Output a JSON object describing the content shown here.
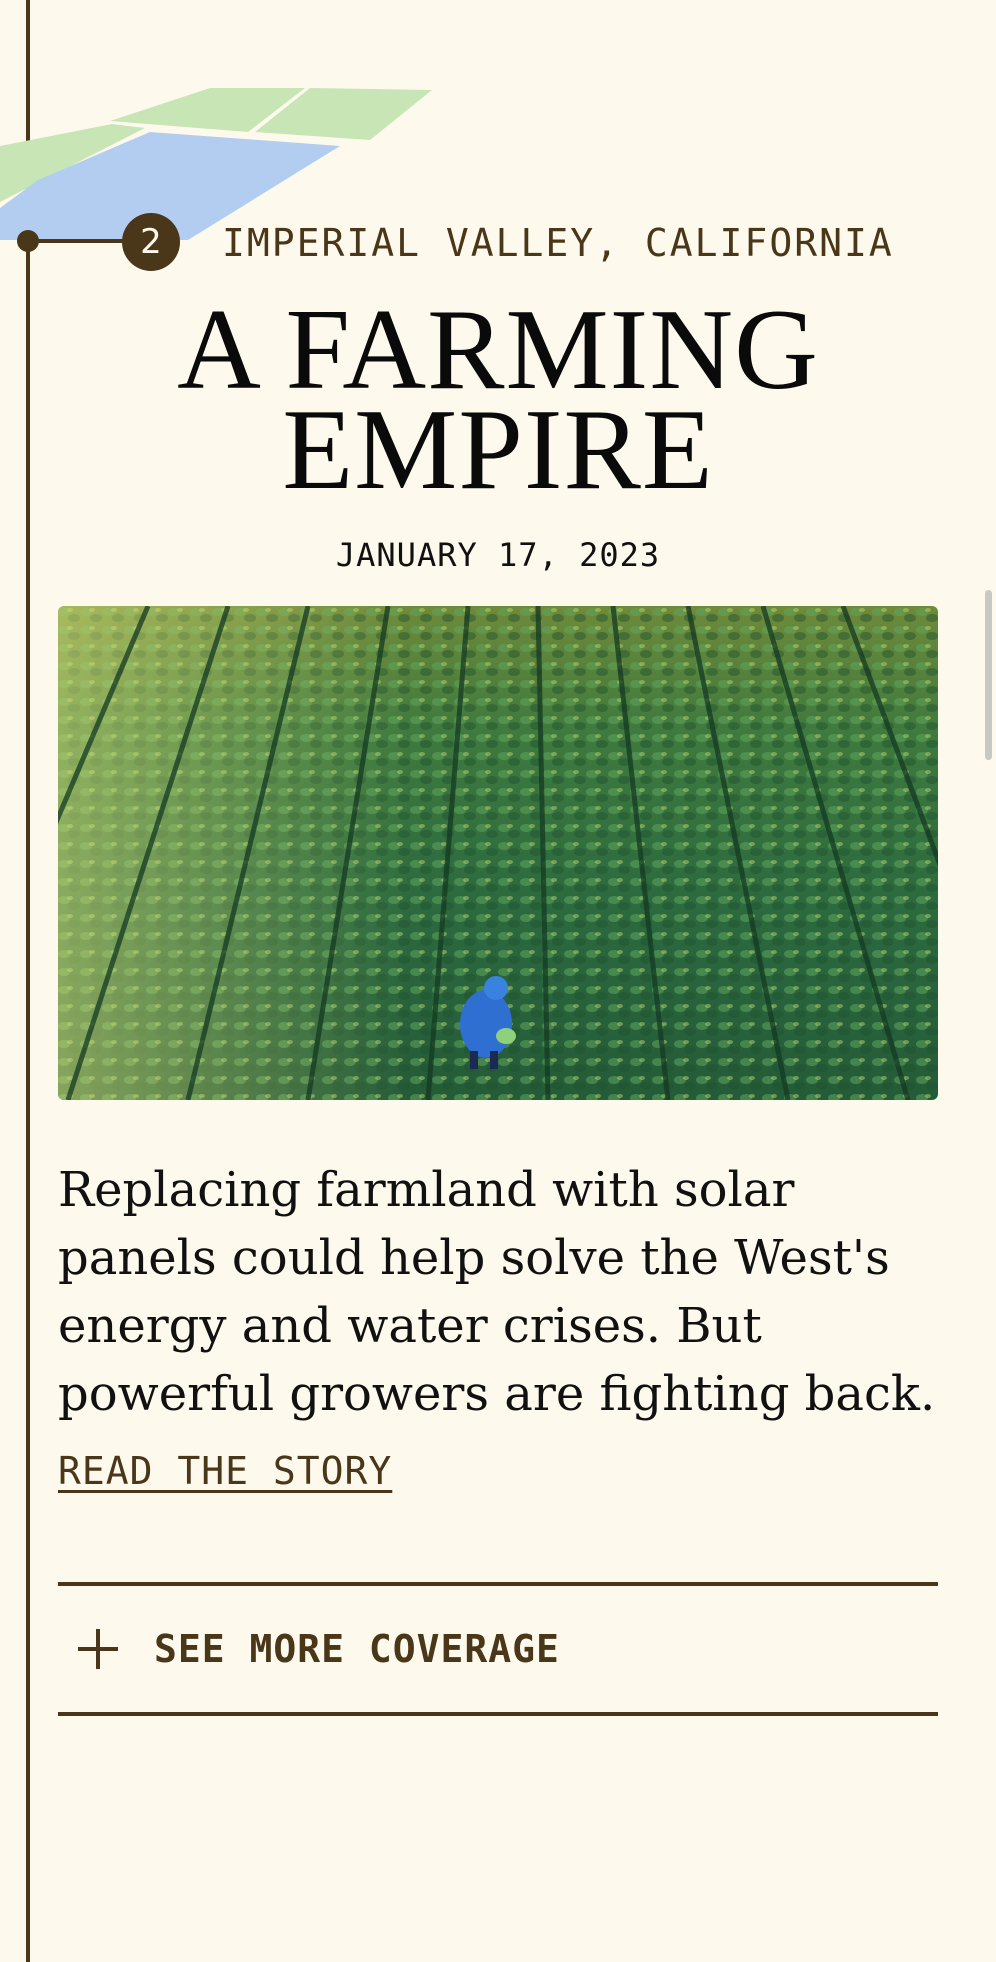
{
  "story": {
    "step_number": "2",
    "location": "IMPERIAL VALLEY, CALIFORNIA",
    "headline": "A FARMING EMPIRE",
    "date": "JANUARY 17, 2023",
    "image_alt_subject": "aerial-farm-field-photo",
    "dek": "Replacing farmland with solar panels could help solve the West's energy and water crises. But powerful growers are fighting back.",
    "read_link": "READ THE STORY"
  },
  "coverage": {
    "toggle_label": "SEE MORE COVERAGE",
    "icon": "plus-icon"
  },
  "colors": {
    "background": "#fdfaed",
    "accent_brown": "#4a3618",
    "map_green": "#c8e6b5",
    "map_blue": "#b2cdef"
  }
}
